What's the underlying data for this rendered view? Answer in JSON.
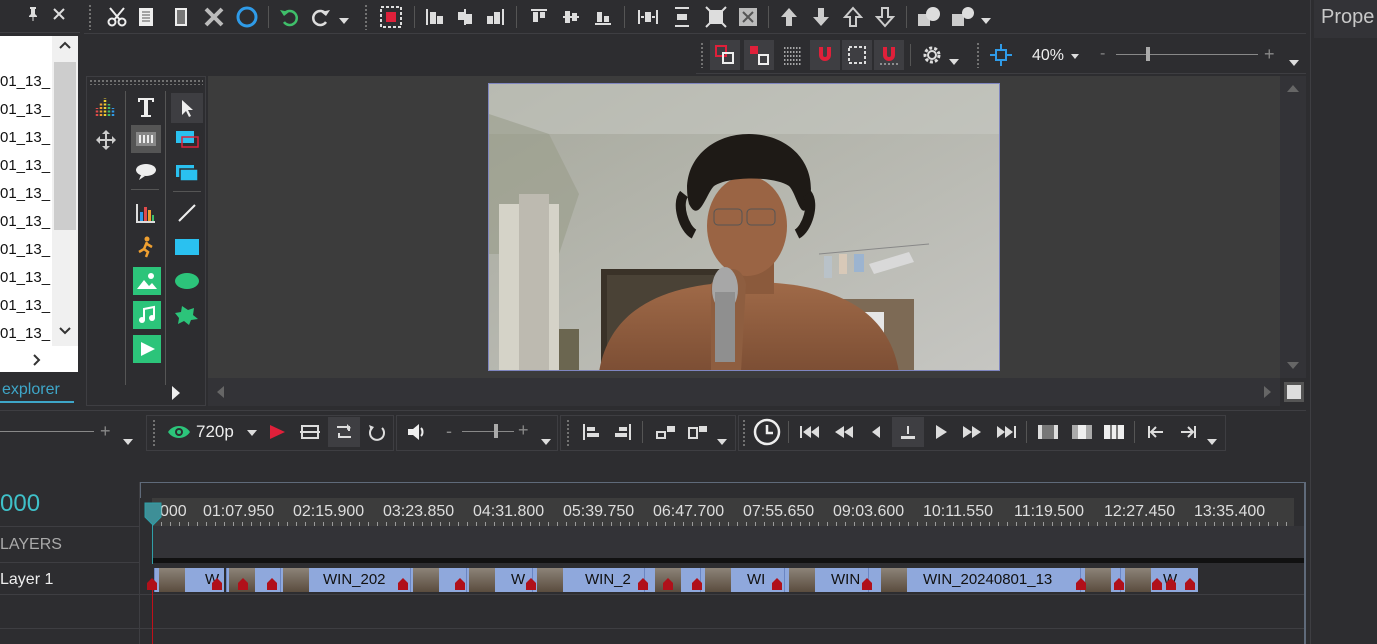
{
  "left_panel": {
    "pin_icon": "pin-icon",
    "close_icon": "close-icon",
    "files": [
      "01_13_",
      "01_13_",
      "01_13_",
      "01_13_",
      "01_13_",
      "01_13_",
      "01_13_",
      "01_13_",
      "01_13_",
      "01_13_"
    ],
    "tab_label": "explorer"
  },
  "right_panel": {
    "title": "Prope"
  },
  "zoom": {
    "value": "40%",
    "minus": "-",
    "plus": "+"
  },
  "playback": {
    "resolution": "720p",
    "volume_minus": "-",
    "volume_plus": "+"
  },
  "left_slider": {
    "plus": "+"
  },
  "timeline": {
    "time_readout": "000",
    "layers_label": "LAYERS",
    "layer_name": "Layer 1",
    "ruler_ticks": [
      "000",
      "01:07.950",
      "02:15.900",
      "03:23.850",
      "04:31.800",
      "05:39.750",
      "06:47.700",
      "07:55.650",
      "09:03.600",
      "10:11.550",
      "11:19.500",
      "12:27.450",
      "13:35.400"
    ],
    "clip_labels": [
      "W",
      "WIN_202",
      "W",
      "WIN_2",
      "WI",
      "WIN",
      "WIN_20240801_13",
      "W"
    ]
  },
  "colors": {
    "accent": "#3fc1c9",
    "clip": "#8fa8dc",
    "marker": "#b0101a",
    "playhead": "#c0101a"
  }
}
